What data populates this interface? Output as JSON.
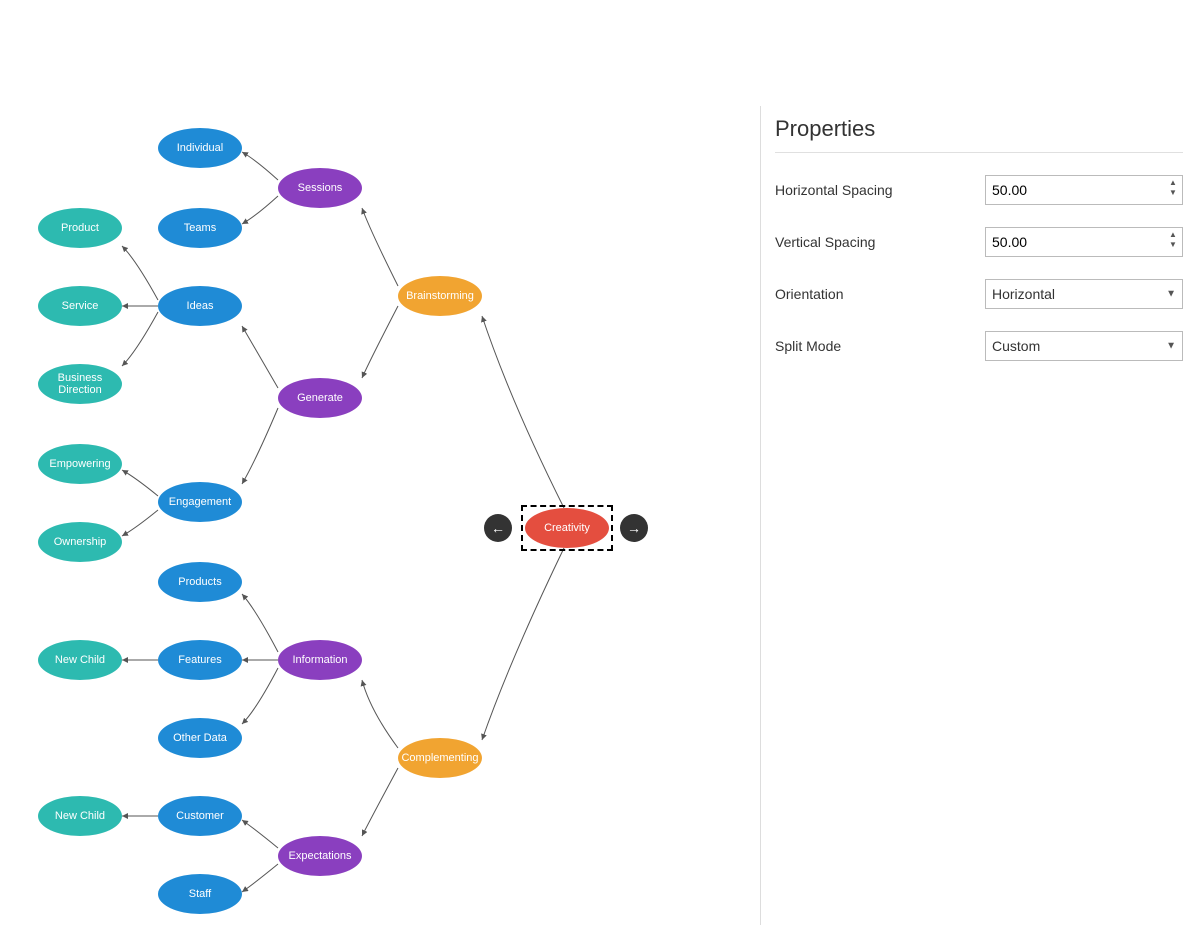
{
  "root": {
    "label": "Creativity"
  },
  "navPrev": "←",
  "navNext": "→",
  "level1": {
    "brainstorming": "Brainstorming",
    "complementing": "Complementing"
  },
  "level2": {
    "sessions": "Sessions",
    "generate": "Generate",
    "information": "Information",
    "expectations": "Expectations"
  },
  "level3": {
    "individual": "Individual",
    "teams": "Teams",
    "ideas": "Ideas",
    "engagement": "Engagement",
    "products": "Products",
    "features": "Features",
    "otherData": "Other Data",
    "customer": "Customer",
    "staff": "Staff"
  },
  "level4": {
    "product": "Product",
    "service": "Service",
    "businessDirection": "Business Direction",
    "empowering": "Empowering",
    "ownership": "Ownership",
    "newChild1": "New Child",
    "newChild2": "New Child"
  },
  "panel": {
    "title": "Properties",
    "hSpacingLabel": "Horizontal Spacing",
    "hSpacingValue": "50.00",
    "vSpacingLabel": "Vertical Spacing",
    "vSpacingValue": "50.00",
    "orientationLabel": "Orientation",
    "orientationValue": "Horizontal",
    "splitModeLabel": "Split Mode",
    "splitModeValue": "Custom"
  }
}
